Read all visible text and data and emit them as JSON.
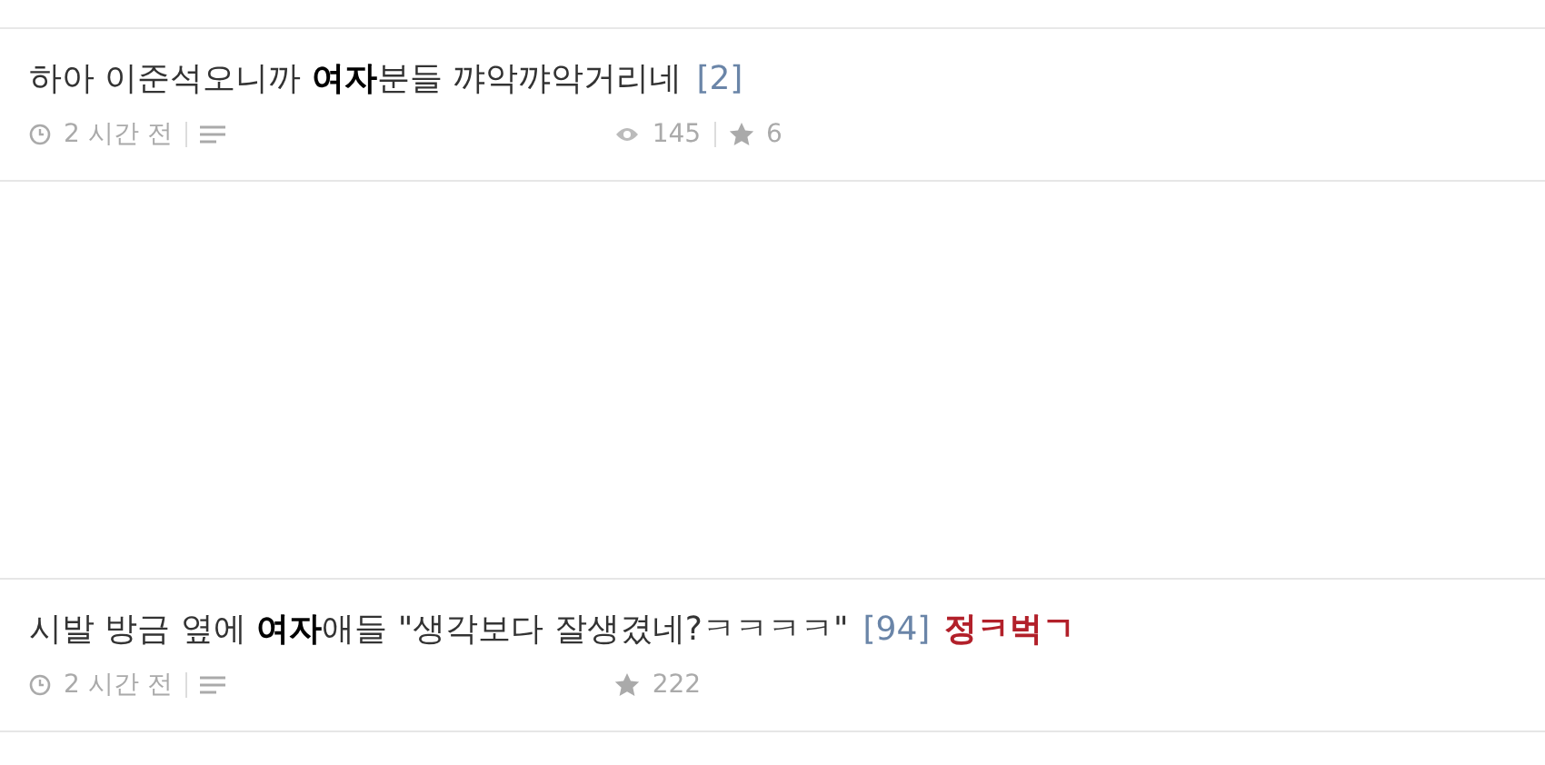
{
  "posts": [
    {
      "title": "하아 이준석오니까 **여자**분들 꺄악꺄악거리네",
      "comments": "[2]",
      "time": "2 시간 전",
      "views": "145",
      "likes": "6"
    },
    {
      "title": "시발 방금 옆에 **여자**애들 \"생각보다 잘생겼네?ㅋㅋㅋㅋ\"",
      "comments": "[94]",
      "badge": "정ㅋ벅ㄱ",
      "time": "2 시간 전",
      "likes": "222"
    }
  ]
}
